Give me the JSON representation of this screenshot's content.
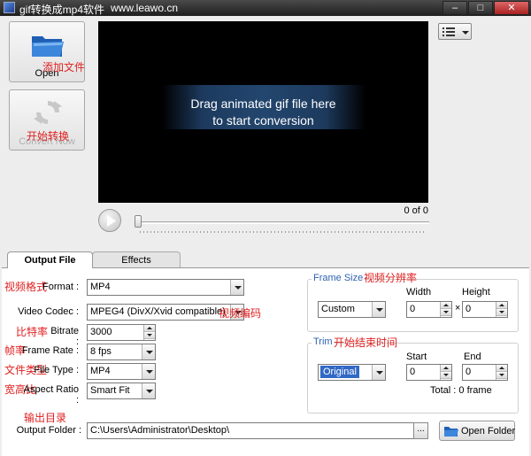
{
  "window": {
    "title": "gif转换成mp4软件",
    "site": "www.leawo.cn",
    "minimize": "–",
    "maximize": "□",
    "close": "✕"
  },
  "toolbar": {
    "open_label": "Open",
    "open_cn": "添加文件",
    "convert_label": "Convert Now",
    "convert_cn": "开始转换"
  },
  "preview": {
    "message_line1": "Drag animated gif file here",
    "message_line2": "to start conversion",
    "counter": "0 of 0"
  },
  "tabs": [
    {
      "label": "Output File",
      "active": true
    },
    {
      "label": "Effects",
      "active": false
    }
  ],
  "output": {
    "format": {
      "label": "Format :",
      "cn": "视频格式",
      "value": "MP4"
    },
    "video_codec": {
      "label": "Video Codec :",
      "cn": "视频编码",
      "value": "MPEG4 (DivX/Xvid compatible)"
    },
    "bitrate": {
      "label": "Bitrate :",
      "cn": "比特率",
      "value": "3000"
    },
    "frame_rate": {
      "label": "Frame Rate :",
      "cn": "帧率",
      "value": "8 fps"
    },
    "file_type": {
      "label": "File Type :",
      "cn": "文件类型",
      "value": "MP4"
    },
    "aspect_ratio": {
      "label": "Aspect Ratio :",
      "cn": "宽高比",
      "value": "Smart Fit"
    },
    "folder": {
      "label": "Output Folder :",
      "cn": "输出目录",
      "value": "C:\\Users\\Administrator\\Desktop\\",
      "browse": "...",
      "open_label": "Open Folder"
    }
  },
  "frame_size": {
    "title": "Frame Size",
    "cn": "视频分辨率",
    "preset": "Custom",
    "width_label": "Width",
    "height_label": "Height",
    "width": "0",
    "height": "0",
    "times": "×"
  },
  "trim": {
    "title": "Trim",
    "cn": "开始结束时间",
    "mode": "Original",
    "start_label": "Start",
    "end_label": "End",
    "start": "0",
    "end": "0",
    "total": "Total : 0 frame"
  },
  "colors": {
    "accent": "#2e62b0",
    "annotation": "#e02020",
    "selection": "#3168c5"
  }
}
